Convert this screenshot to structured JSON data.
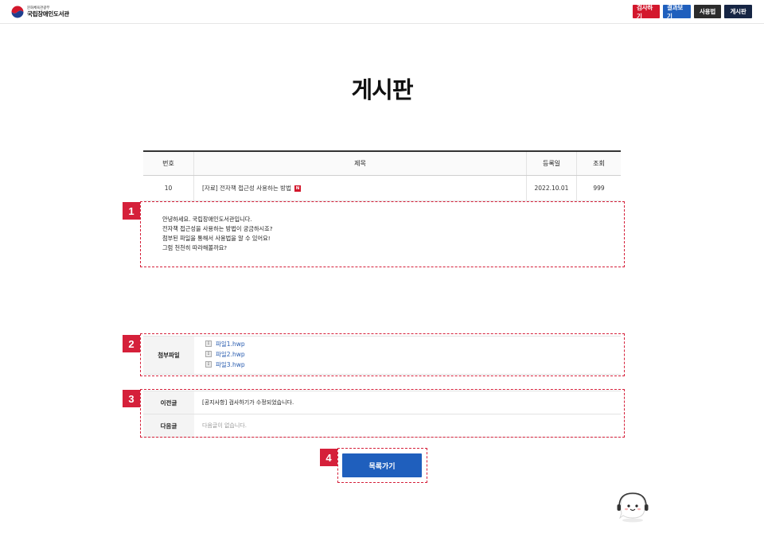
{
  "header": {
    "logo_sub": "문화체육관광부",
    "logo_main": "국립장애인도서관",
    "nav": [
      {
        "label": "검사하기",
        "color": "#d3172c"
      },
      {
        "label": "결과보기",
        "color": "#1f5fbd"
      },
      {
        "label": "사용법",
        "color": "#2b2b2b"
      },
      {
        "label": "게시판",
        "color": "#162544"
      }
    ]
  },
  "page_title": "게시판",
  "board": {
    "columns": [
      "번호",
      "제목",
      "등록일",
      "조회"
    ],
    "row": {
      "no": "10",
      "title": "[자료] 전자책 접근성 사용하는 방법",
      "badge": "N",
      "date": "2022.10.01",
      "views": "999"
    }
  },
  "markers": [
    "1",
    "2",
    "3",
    "4"
  ],
  "content_lines": [
    "안녕하세요. 국립장애인도서관입니다.",
    "전자책 접근성을 사용하는 방법이 궁금하시죠?",
    "첨부된 파일을 통해서 사용법을 알 수 있어요!",
    "그럼 천천히 따라해볼까요?"
  ],
  "attachments": {
    "label": "첨부파일",
    "files": [
      "파일1.hwp",
      "파일2.hwp",
      "파일3.hwp"
    ]
  },
  "prev_next": {
    "prev_label": "이전글",
    "prev_value": "[공지사항] 검사하기가 수정되었습니다.",
    "next_label": "다음글",
    "next_value": "다음글이 없습니다."
  },
  "list_button": "목록가기",
  "icons": [
    "government-emblem-icon",
    "file-icon",
    "chatbot-icon"
  ],
  "accent_color": "#d5203a"
}
